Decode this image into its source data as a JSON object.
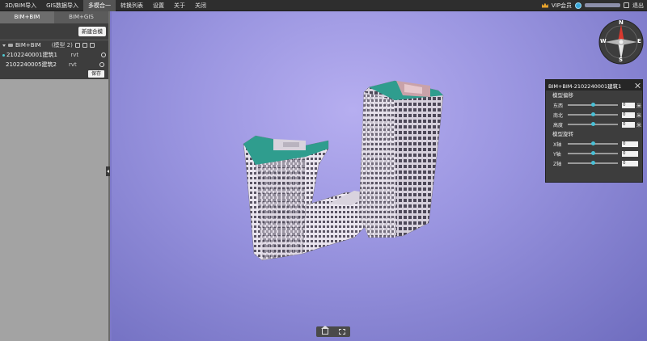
{
  "menu": [
    "3D/BIM导入",
    "GIS数据导入",
    "多模合一",
    "转换列表",
    "设置",
    "关于",
    "关闭"
  ],
  "menu_active": 2,
  "user": {
    "vip_label": "VIP会员",
    "logout_label": "退出",
    "crown_color": "#e8a32c"
  },
  "left_panel": {
    "tabs": [
      "BIM+BIM",
      "BIM+GIS"
    ],
    "active_tab": 0,
    "new_button": "新建合模",
    "group": {
      "name": "BIM+BIM",
      "count": "(模型 2)"
    },
    "items": [
      {
        "name": "2102240001建筑1",
        "type": "rvt"
      },
      {
        "name": "2102240005建筑2",
        "type": "rvt"
      }
    ],
    "save_button": "保存"
  },
  "compass": {
    "n": "N",
    "e": "E",
    "s": "S",
    "w": "W"
  },
  "properties": {
    "title": "BIM+BIM-2102240001建筑1",
    "offset_title": "模型偏移",
    "offset_rows": [
      {
        "label": "东西",
        "value": "0",
        "unit": "米",
        "level": 0.5
      },
      {
        "label": "南北",
        "value": "0",
        "unit": "米",
        "level": 0.5
      },
      {
        "label": "高度",
        "value": "0",
        "unit": "米",
        "level": 0.5
      }
    ],
    "rotate_title": "模型旋转",
    "rotate_rows": [
      {
        "label": "X轴",
        "value": "0",
        "level": 0.5
      },
      {
        "label": "Y轴",
        "value": "0",
        "level": 0.5
      },
      {
        "label": "Z轴",
        "value": "0",
        "level": 0.5
      }
    ],
    "accent": "#49c0d6"
  }
}
